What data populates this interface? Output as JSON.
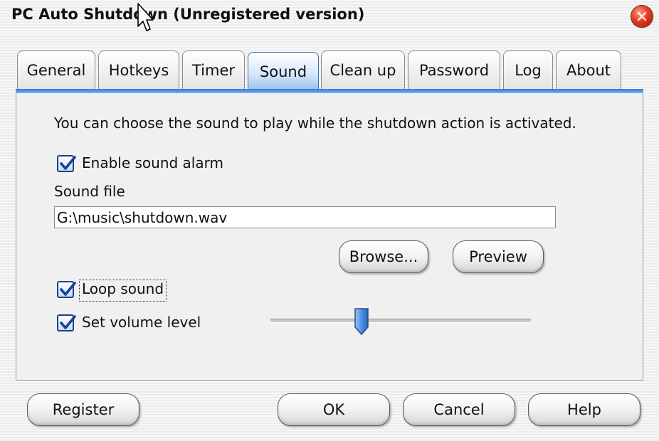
{
  "window": {
    "title": "PC Auto Shutdown (Unregistered version)"
  },
  "tabs": [
    {
      "label": "General",
      "active": false
    },
    {
      "label": "Hotkeys",
      "active": false
    },
    {
      "label": "Timer",
      "active": false
    },
    {
      "label": "Sound",
      "active": true
    },
    {
      "label": "Clean up",
      "active": false
    },
    {
      "label": "Password",
      "active": false
    },
    {
      "label": "Log",
      "active": false
    },
    {
      "label": "About",
      "active": false
    }
  ],
  "sound": {
    "description": "You can choose the sound to play while the shutdown action is activated.",
    "enable_sound_alarm": {
      "label": "Enable sound alarm",
      "checked": true
    },
    "sound_file_label": "Sound file",
    "sound_file_value": "G:\\music\\shutdown.wav",
    "browse_label": "Browse...",
    "preview_label": "Preview",
    "loop_sound": {
      "label": "Loop sound",
      "checked": true
    },
    "set_volume_level": {
      "label": "Set volume level",
      "checked": true
    },
    "volume_level": 0.35
  },
  "footer": {
    "register_label": "Register",
    "ok_label": "OK",
    "cancel_label": "Cancel",
    "help_label": "Help"
  },
  "colors": {
    "accent": "#2e7cd6",
    "close_button": "#e23a20"
  },
  "icons": [
    "close-icon",
    "checkmark-icon",
    "mouse-cursor-icon",
    "slider-thumb-icon"
  ]
}
